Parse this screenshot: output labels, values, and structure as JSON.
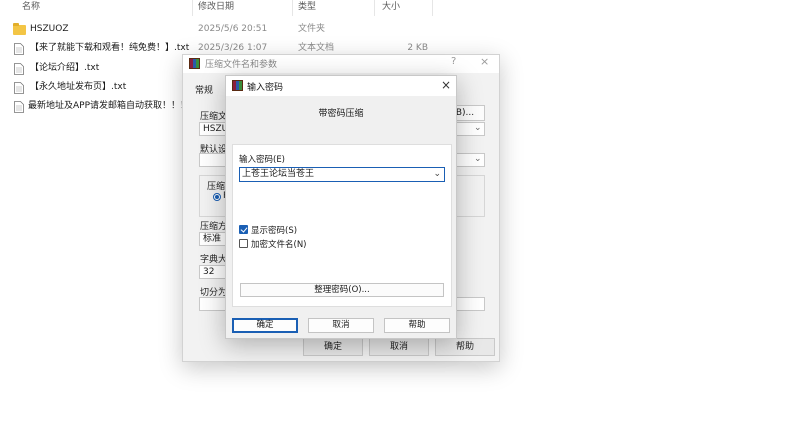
{
  "explorer": {
    "columns": {
      "name": "名称",
      "date": "修改日期",
      "type": "类型",
      "size": "大小"
    },
    "files": [
      {
        "name": "HSZUOZ",
        "date": "2025/5/6 20:51",
        "type": "文件夹",
        "size": "",
        "icon": "folder-icon"
      },
      {
        "name": "【来了就能下载和观看！纯免费！】.txt",
        "date": "2025/3/26 1:07",
        "type": "文本文档",
        "size": "2 KB",
        "icon": "text-file-icon"
      },
      {
        "name": "【论坛介绍】.txt",
        "date": "",
        "type": "",
        "size": "",
        "icon": "text-file-icon"
      },
      {
        "name": "【永久地址发布页】.txt",
        "date": "",
        "type": "",
        "size": "",
        "icon": "text-file-icon"
      },
      {
        "name": "最新地址及APP请发邮箱自动获取！！！...",
        "date": "",
        "type": "",
        "size": "",
        "icon": "text-file-icon"
      }
    ]
  },
  "archive_dialog": {
    "title": "压缩文件名和参数",
    "help_glyph": "?",
    "close_glyph": "×",
    "tab": "常规",
    "archive_name_label": "压缩文",
    "archive_name_value": "HSZUO",
    "browse_label": "B)...",
    "default_label": "默认设",
    "format_label": "压缩文",
    "radio_label": "R",
    "method_label": "压缩方",
    "method_value": "标准",
    "dict_label": "字典大",
    "dict_value": "32",
    "split_label": "切分为",
    "ok_label": "确定",
    "cancel_label": "取消",
    "help_label": "帮助"
  },
  "password_dialog": {
    "title": "输入密码",
    "close_glyph": "×",
    "heading": "带密码压缩",
    "password_label": "输入密码(E)",
    "password_value": "上苍王论坛当苍王",
    "show_password_label": "显示密码(S)",
    "show_password_checked": true,
    "encrypt_names_label": "加密文件名(N)",
    "encrypt_names_checked": false,
    "manage_label": "整理密码(O)...",
    "ok_label": "确定",
    "cancel_label": "取消",
    "help_label": "帮助"
  }
}
